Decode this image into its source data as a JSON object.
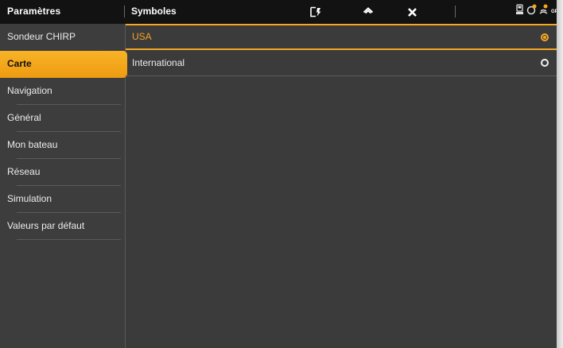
{
  "header": {
    "left_title": "Paramètres",
    "section_title": "Symboles",
    "toolbar_icons": [
      "exit-screen-icon",
      "home-icon",
      "close-icon"
    ],
    "status_icons": [
      "gps-receiver-icon",
      "satellite-icon",
      "signal-icon"
    ],
    "gps_label": "GPS"
  },
  "sidebar": {
    "items": [
      {
        "label": "Sondeur CHIRP",
        "active": false
      },
      {
        "label": "Carte",
        "active": true
      },
      {
        "label": "Navigation",
        "active": false
      },
      {
        "label": "Général",
        "active": false
      },
      {
        "label": "Mon bateau",
        "active": false
      },
      {
        "label": "Réseau",
        "active": false
      },
      {
        "label": "Simulation",
        "active": false
      },
      {
        "label": "Valeurs par défaut",
        "active": false
      }
    ]
  },
  "options": {
    "items": [
      {
        "label": "USA",
        "selected": true
      },
      {
        "label": "International",
        "selected": false
      }
    ]
  },
  "colors": {
    "accent": "#f5a623",
    "background": "#3b3b3c",
    "topbar": "#121212"
  }
}
